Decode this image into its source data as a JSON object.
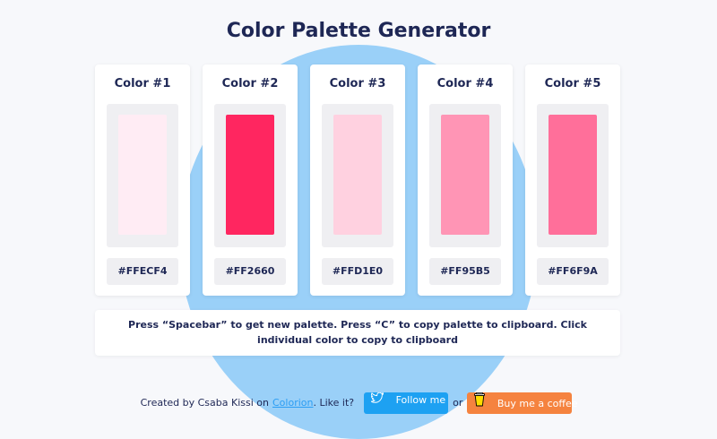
{
  "title": "Color Palette Generator",
  "colors": [
    {
      "label": "Color #1",
      "hex": "#FFECF4"
    },
    {
      "label": "Color #2",
      "hex": "#FF2660"
    },
    {
      "label": "Color #3",
      "hex": "#FFD1E0"
    },
    {
      "label": "Color #4",
      "hex": "#FF95B5"
    },
    {
      "label": "Color #5",
      "hex": "#FF6F9A"
    }
  ],
  "instructions": "Press “Spacebar” to get new palette. Press “C” to copy palette to clipboard. Click individual color to copy to clipboard",
  "footer": {
    "created_by": "Created by Csaba Kissi on",
    "link_text": "Colorion",
    "like_it": ". Like it?",
    "follow_label": "Follow me",
    "or": "or",
    "coffee_label": "Buy me a coffee"
  },
  "icons": {
    "follow": "twitter-icon",
    "coffee": "coffee-cup-icon"
  },
  "theme": {
    "background": "#f7f8fb",
    "blob": "#9ad0f8",
    "text": "#1e2755",
    "twitter": "#1da1f2",
    "coffee": "#f5833f"
  }
}
